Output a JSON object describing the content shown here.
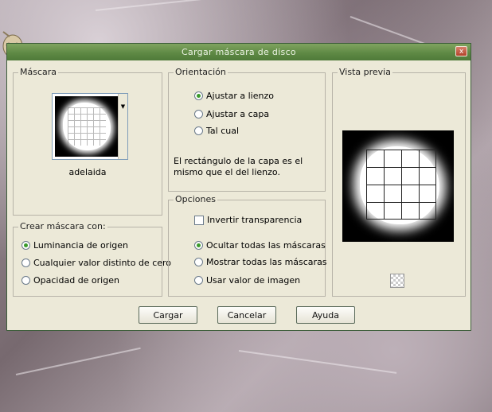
{
  "dialog": {
    "title": "Cargar máscara de disco",
    "close_glyph": "x"
  },
  "mask": {
    "legend": "Máscara",
    "selected_name": "adelaida",
    "dropdown_arrow": "▼"
  },
  "create_mask": {
    "legend": "Crear máscara con:",
    "options": [
      {
        "label": "Luminancia de origen",
        "selected": true
      },
      {
        "label": "Cualquier valor distinto de cero",
        "selected": false
      },
      {
        "label": "Opacidad de origen",
        "selected": false
      }
    ]
  },
  "orientation": {
    "legend": "Orientación",
    "options": [
      {
        "label": "Ajustar a lienzo",
        "selected": true
      },
      {
        "label": "Ajustar a capa",
        "selected": false
      },
      {
        "label": "Tal cual",
        "selected": false
      }
    ],
    "note": "El rectángulo de la capa es el mismo que el del lienzo."
  },
  "options": {
    "legend": "Opciones",
    "invert_label": "Invertir transparencia",
    "invert_checked": false,
    "mask_options": [
      {
        "label": "Ocultar todas las máscaras",
        "selected": true
      },
      {
        "label": "Mostrar todas las máscaras",
        "selected": false
      },
      {
        "label": "Usar valor de imagen",
        "selected": false
      }
    ]
  },
  "preview": {
    "legend": "Vista previa"
  },
  "buttons": {
    "load": "Cargar",
    "cancel": "Cancelar",
    "help": "Ayuda"
  },
  "icons": {
    "skull": "skull-icon",
    "transparency": "checkerboard-icon"
  }
}
